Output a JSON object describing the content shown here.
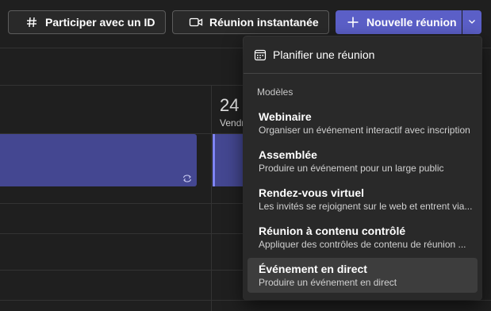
{
  "toolbar": {
    "join_label": "Participer avec un ID",
    "instant_label": "Réunion instantanée",
    "new_label": "Nouvelle réunion",
    "join_icon": "hash-icon",
    "instant_icon": "video-icon",
    "new_icon": "plus-icon",
    "chevron_icon": "chevron-down-icon",
    "accent_color": "#5b5fc7"
  },
  "calendar": {
    "day_number": "24",
    "day_name": "Vendr",
    "event_color": "#444791"
  },
  "menu": {
    "schedule_label": "Planifier une réunion",
    "section_label": "Modèles",
    "items": [
      {
        "title": "Webinaire",
        "desc": "Organiser un événement interactif avec inscription"
      },
      {
        "title": "Assemblée",
        "desc": "Produire un événement pour un large public"
      },
      {
        "title": "Rendez-vous virtuel",
        "desc": "Les invités se rejoignent sur le web et entrent via..."
      },
      {
        "title": "Réunion à contenu contrôlé",
        "desc": "Appliquer des contrôles de contenu de réunion ..."
      },
      {
        "title": "Événement en direct",
        "desc": "Produire un événement en direct"
      }
    ]
  }
}
